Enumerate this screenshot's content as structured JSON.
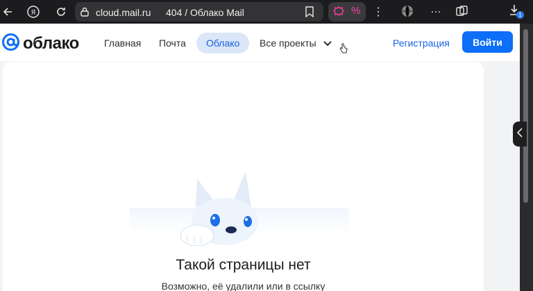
{
  "browser": {
    "url": "cloud.mail.ru",
    "tab_title": "404 / Облако Mail",
    "badge_count": "1"
  },
  "header": {
    "logo_text": "облако",
    "nav": [
      {
        "label": "Главная"
      },
      {
        "label": "Почта"
      },
      {
        "label": "Облако",
        "active": true
      },
      {
        "label": "Все проекты"
      }
    ],
    "register_label": "Регистрация",
    "login_label": "Войти"
  },
  "error": {
    "title": "Такой страницы нет",
    "subtitle": "Возможно, её удалили или в ссылку"
  },
  "colors": {
    "brand_blue": "#0d6ef7",
    "active_nav_bg": "#dbe6f8",
    "chrome_dark": "#1c1c1e"
  }
}
